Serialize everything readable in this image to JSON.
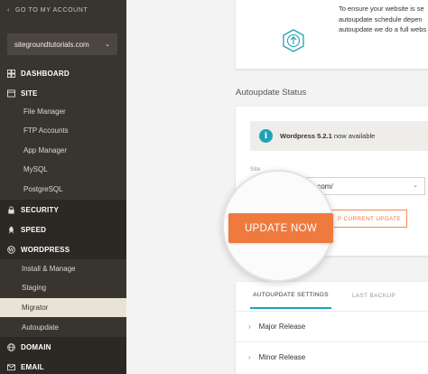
{
  "sidebar": {
    "go_account": "GO TO MY ACCOUNT",
    "site_select": "sitegroundtutorials.com",
    "sections": {
      "dashboard": "DASHBOARD",
      "site": "SITE",
      "security": "SECURITY",
      "speed": "SPEED",
      "wordpress": "WORDPRESS",
      "domain": "DOMAIN",
      "email": "EMAIL"
    },
    "site_items": [
      "File Manager",
      "FTP Accounts",
      "App Manager",
      "MySQL",
      "PostgreSQL"
    ],
    "wordpress_items": [
      "Install & Manage",
      "Staging",
      "Migrator",
      "Autoupdate"
    ],
    "active_item": "Migrator"
  },
  "main": {
    "info_lines": [
      "To ensure your website is se",
      "autoupdate schedule depen",
      "autoupdate we do a full webs"
    ],
    "section_title": "Autoupdate Status",
    "available": {
      "version": "Wordpress 5.2.1",
      "suffix": "now available"
    },
    "site_label": "Site",
    "site_value": "orials.com/",
    "update_current": "P CURRENT UPDATE",
    "update_now": "UPDATE NOW",
    "tabs": [
      "AUTOUPDATE SETTINGS",
      "LAST BACKUP"
    ],
    "rows": [
      "Major Release",
      "Minor Release"
    ]
  },
  "colors": {
    "sidebar_bg": "#38352f",
    "accent_orange": "#ef7a3f",
    "accent_teal": "#1fa2b8",
    "active_item_bg": "#e9e3d6"
  }
}
